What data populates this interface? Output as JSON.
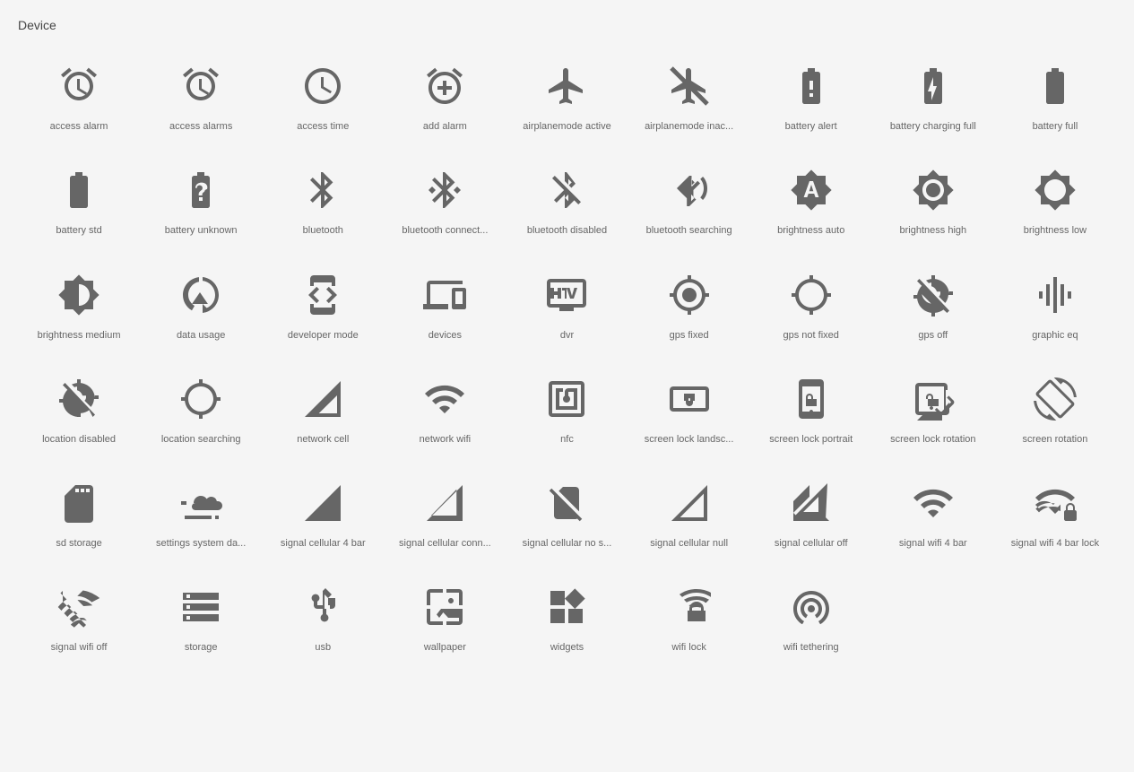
{
  "title": "Device",
  "icons": [
    {
      "id": "access-alarm",
      "label": "access alarm"
    },
    {
      "id": "access-alarms",
      "label": "access alarms"
    },
    {
      "id": "access-time",
      "label": "access time"
    },
    {
      "id": "add-alarm",
      "label": "add alarm"
    },
    {
      "id": "airplanemode-active",
      "label": "airplanemode active"
    },
    {
      "id": "airplanemode-inactive",
      "label": "airplanemode inac..."
    },
    {
      "id": "battery-alert",
      "label": "battery alert"
    },
    {
      "id": "battery-charging-full",
      "label": "battery charging full"
    },
    {
      "id": "battery-full",
      "label": "battery full"
    },
    {
      "id": "battery-std",
      "label": "battery std"
    },
    {
      "id": "battery-unknown",
      "label": "battery unknown"
    },
    {
      "id": "bluetooth",
      "label": "bluetooth"
    },
    {
      "id": "bluetooth-connected",
      "label": "bluetooth connect..."
    },
    {
      "id": "bluetooth-disabled",
      "label": "bluetooth disabled"
    },
    {
      "id": "bluetooth-searching",
      "label": "bluetooth searching"
    },
    {
      "id": "brightness-auto",
      "label": "brightness auto"
    },
    {
      "id": "brightness-high",
      "label": "brightness high"
    },
    {
      "id": "brightness-low",
      "label": "brightness low"
    },
    {
      "id": "brightness-medium",
      "label": "brightness medium"
    },
    {
      "id": "data-usage",
      "label": "data usage"
    },
    {
      "id": "developer-mode",
      "label": "developer mode"
    },
    {
      "id": "devices",
      "label": "devices"
    },
    {
      "id": "dvr",
      "label": "dvr"
    },
    {
      "id": "gps-fixed",
      "label": "gps fixed"
    },
    {
      "id": "gps-not-fixed",
      "label": "gps not fixed"
    },
    {
      "id": "gps-off",
      "label": "gps off"
    },
    {
      "id": "graphic-eq",
      "label": "graphic eq"
    },
    {
      "id": "location-disabled",
      "label": "location disabled"
    },
    {
      "id": "location-searching",
      "label": "location searching"
    },
    {
      "id": "network-cell",
      "label": "network cell"
    },
    {
      "id": "network-wifi",
      "label": "network wifi"
    },
    {
      "id": "nfc",
      "label": "nfc"
    },
    {
      "id": "screen-lock-landscape",
      "label": "screen lock landsc..."
    },
    {
      "id": "screen-lock-portrait",
      "label": "screen lock portrait"
    },
    {
      "id": "screen-lock-rotation",
      "label": "screen lock rotation"
    },
    {
      "id": "screen-rotation",
      "label": "screen rotation"
    },
    {
      "id": "sd-storage",
      "label": "sd storage"
    },
    {
      "id": "settings-system-daydream",
      "label": "settings system da..."
    },
    {
      "id": "signal-cellular-4bar",
      "label": "signal cellular 4 bar"
    },
    {
      "id": "signal-cellular-connected",
      "label": "signal cellular conn..."
    },
    {
      "id": "signal-cellular-no-sim",
      "label": "signal cellular no s..."
    },
    {
      "id": "signal-cellular-null",
      "label": "signal cellular null"
    },
    {
      "id": "signal-cellular-off",
      "label": "signal cellular off"
    },
    {
      "id": "signal-wifi-4bar",
      "label": "signal wifi 4 bar"
    },
    {
      "id": "signal-wifi-4bar-lock",
      "label": "signal wifi 4 bar lock"
    },
    {
      "id": "signal-wifi-off",
      "label": "signal wifi off"
    },
    {
      "id": "storage",
      "label": "storage"
    },
    {
      "id": "usb",
      "label": "usb"
    },
    {
      "id": "wallpaper",
      "label": "wallpaper"
    },
    {
      "id": "widgets",
      "label": "widgets"
    },
    {
      "id": "wifi-lock",
      "label": "wifi lock"
    },
    {
      "id": "wifi-tethering",
      "label": "wifi tethering"
    }
  ]
}
